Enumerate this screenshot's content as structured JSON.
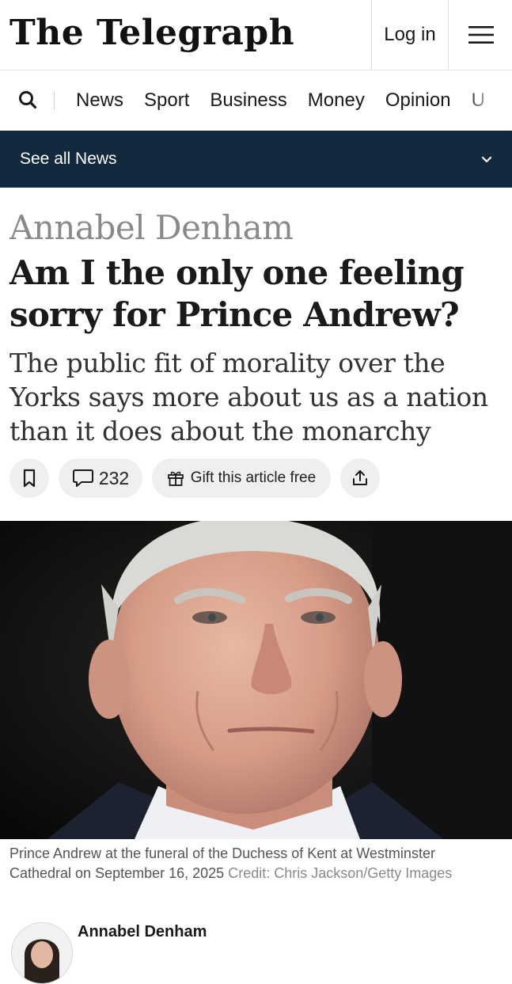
{
  "header": {
    "logo_text": "The Telegraph",
    "login_label": "Log in",
    "menu_icon": "hamburger-icon"
  },
  "nav": {
    "search_icon": "search-icon",
    "items": [
      {
        "label": "News"
      },
      {
        "label": "Sport"
      },
      {
        "label": "Business"
      },
      {
        "label": "Money"
      },
      {
        "label": "Opinion"
      },
      {
        "label": "U"
      }
    ]
  },
  "section_bar": {
    "label": "See all News",
    "icon": "chevron-down-icon",
    "background": "#132a3e"
  },
  "article": {
    "author_kicker": "Annabel Denham",
    "headline": "Am I the only one feeling sorry for Prince Andrew?",
    "standfirst": "The public fit of morality over the Yorks says more about us as a nation than it does about the monarchy",
    "actions": {
      "bookmark_icon": "bookmark-icon",
      "comment_icon": "comment-icon",
      "comment_count": "232",
      "gift_icon": "gift-icon",
      "gift_label": "Gift this article free",
      "share_icon": "share-icon"
    },
    "image": {
      "caption": "Prince Andrew at the funeral of the Duchess of Kent at Westminster Cathedral on September 16, 2025",
      "credit": "Credit: Chris Jackson/Getty Images"
    },
    "author": {
      "name": "Annabel Denham"
    }
  }
}
